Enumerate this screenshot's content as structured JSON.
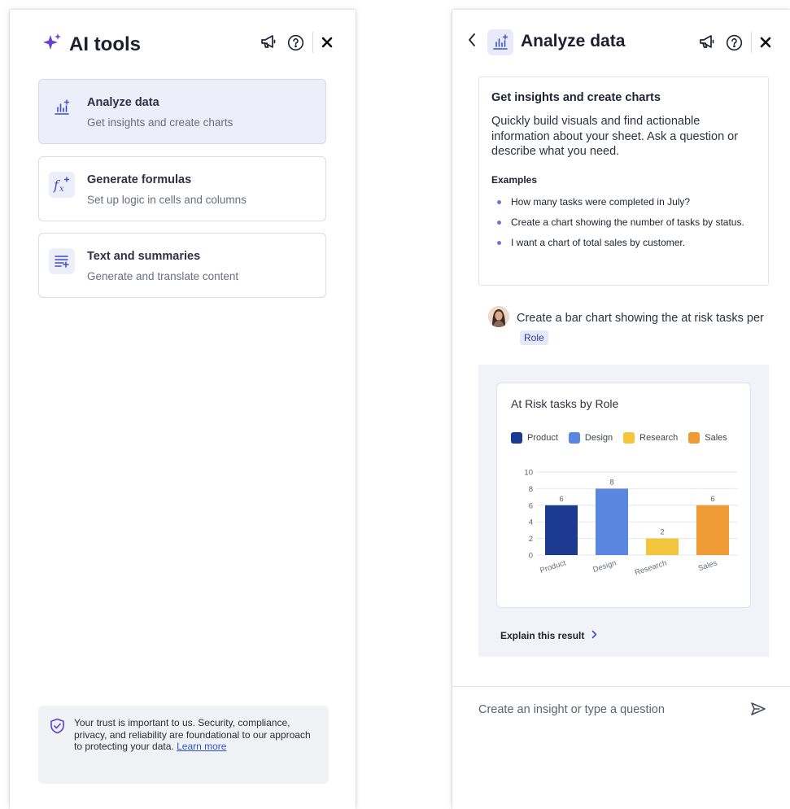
{
  "colors": {
    "accent": "#6a3fd4",
    "card_active_bg": "#eceefa",
    "link": "#2a53d6",
    "chip_bg": "#e5e8fb"
  },
  "left_panel": {
    "title": "AI tools",
    "title_icon": "sparkle-icon",
    "header_icons": [
      "megaphone-icon",
      "help-icon",
      "close-icon"
    ],
    "tools": [
      {
        "icon": "analyze-chart-icon",
        "title": "Analyze data",
        "description": "Get insights and create charts",
        "active": true
      },
      {
        "icon": "formula-icon",
        "title": "Generate formulas",
        "description": "Set up logic in cells and columns",
        "active": false
      },
      {
        "icon": "text-summary-icon",
        "title": "Text and summaries",
        "description": "Generate and translate content",
        "active": false
      }
    ],
    "trust": {
      "icon": "shield-check-icon",
      "text": "Your trust is important to us. Security, compliance, privacy, and reliability are foundational to our approach to protecting your data.",
      "link": "Learn more"
    }
  },
  "right_panel": {
    "title": "Analyze data",
    "title_icon": "analyze-chart-icon",
    "header_icons": [
      "back-chevron-icon",
      "megaphone-icon",
      "help-icon",
      "close-icon"
    ],
    "info": {
      "title": "Get insights and create charts",
      "description": "Quickly build visuals and find actionable information about your sheet. Ask a question or describe what you need.",
      "examples_heading": "Examples",
      "examples": [
        "How many tasks were completed in July?",
        "Create a chart showing the number of tasks by status.",
        "I want a chart of total sales by customer."
      ]
    },
    "user_message": {
      "text": "Create a bar chart showing the at risk tasks per",
      "chip": "Role"
    },
    "explain_label": "Explain this result",
    "input": {
      "placeholder": "Create an insight or type a question",
      "value": ""
    },
    "send_icon": "send-icon"
  },
  "chart_data": {
    "type": "bar",
    "title": "At Risk tasks by Role",
    "categories": [
      "Product",
      "Design",
      "Research",
      "Sales"
    ],
    "values": [
      6,
      8,
      2,
      6
    ],
    "colors": [
      "#1c3a8f",
      "#5b86e0",
      "#f2c53d",
      "#f09a36"
    ],
    "legend": [
      "Product",
      "Design",
      "Research",
      "Sales"
    ],
    "legend_position": "top",
    "ylim": [
      0,
      10
    ],
    "yticks": [
      0,
      2,
      4,
      6,
      8,
      10
    ],
    "data_labels": true,
    "grid": true,
    "xlabel": "",
    "ylabel": ""
  }
}
